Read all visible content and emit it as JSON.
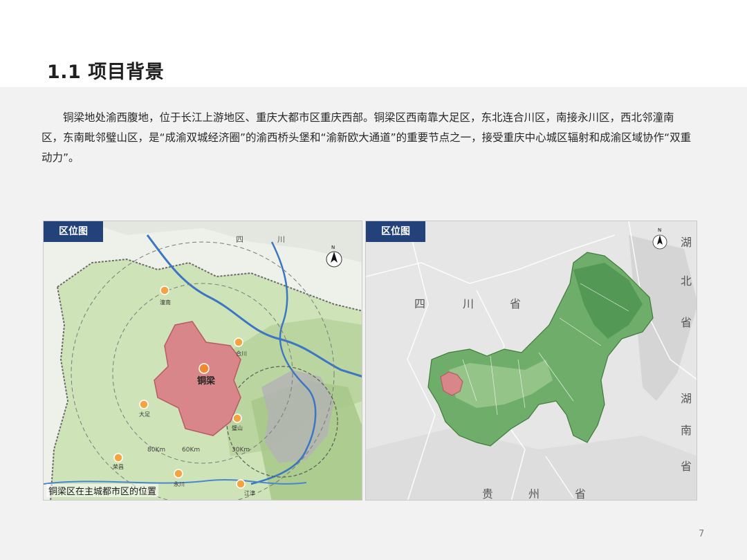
{
  "page": {
    "title": "1.1 项目背景",
    "paragraph": "铜梁地处渝西腹地，位于长江上游地区、重庆大都市区重庆西部。铜梁区西南靠大足区，东北连合川区，南接永川区，西北邻潼南区，东南毗邻璧山区，是“成渝双城经济圈”的渝西桥头堡和“渝新欧大通道”的重要节点之一，接受重庆中心城区辐射和成渝区域协作“双重动力”。",
    "page_number": "7"
  },
  "left_map": {
    "tab_label": "区位图",
    "caption": "铜梁区在主城都市区的位置",
    "province_label_1": "四",
    "province_label_2": "川",
    "center_city": "铜梁",
    "cities": [
      "潼南",
      "合川",
      "大足",
      "璧山",
      "永川",
      "荣昌",
      "江津"
    ],
    "ring_labels": [
      "80Km",
      "60Km",
      "30Km"
    ],
    "compass_label": "N"
  },
  "right_map": {
    "tab_label": "区位图",
    "province_labels": {
      "sichuan": [
        "四",
        "川",
        "省"
      ],
      "hubei": [
        "湖",
        "北",
        "省"
      ],
      "hunan": [
        "湖",
        "南",
        "省"
      ],
      "guizhou": [
        "贵",
        "州",
        "省"
      ]
    },
    "compass_label": "N"
  },
  "colors": {
    "tab_background": "#23427a",
    "tongliang_highlight": "#d9868a",
    "map_green": "#6fae6a"
  }
}
